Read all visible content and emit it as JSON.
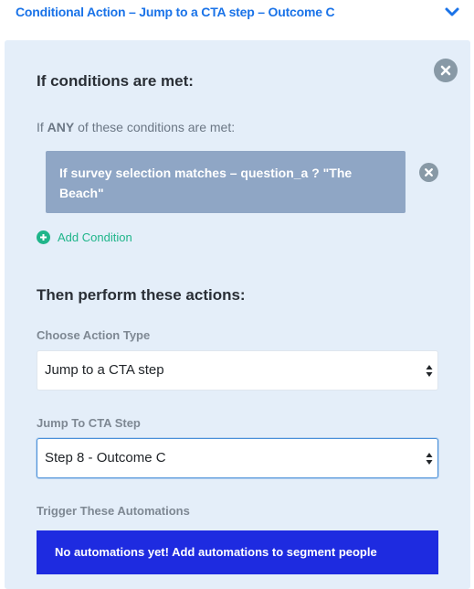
{
  "header": {
    "title": "Conditional Action – Jump to a CTA step – Outcome C",
    "chevron_icon": "chevron-down-icon",
    "accent_color": "#1a73e8"
  },
  "panel": {
    "close_icon": "close-icon",
    "conditions_heading": "If conditions are met:",
    "match_prefix": "If",
    "match_mode": "ANY",
    "match_suffix": "of these conditions are met:",
    "conditions": [
      {
        "text": "If survey selection matches – question_a ? \"The Beach\""
      }
    ],
    "add_condition_label": "Add Condition",
    "actions_heading": "Then perform these actions:",
    "action_type_label": "Choose Action Type",
    "action_type_value": "Jump to a CTA step",
    "jump_label": "Jump To CTA Step",
    "jump_value": "Step 8 - Outcome C",
    "automations_label": "Trigger These Automations",
    "automations_empty": "No automations yet! Add automations to segment people"
  }
}
